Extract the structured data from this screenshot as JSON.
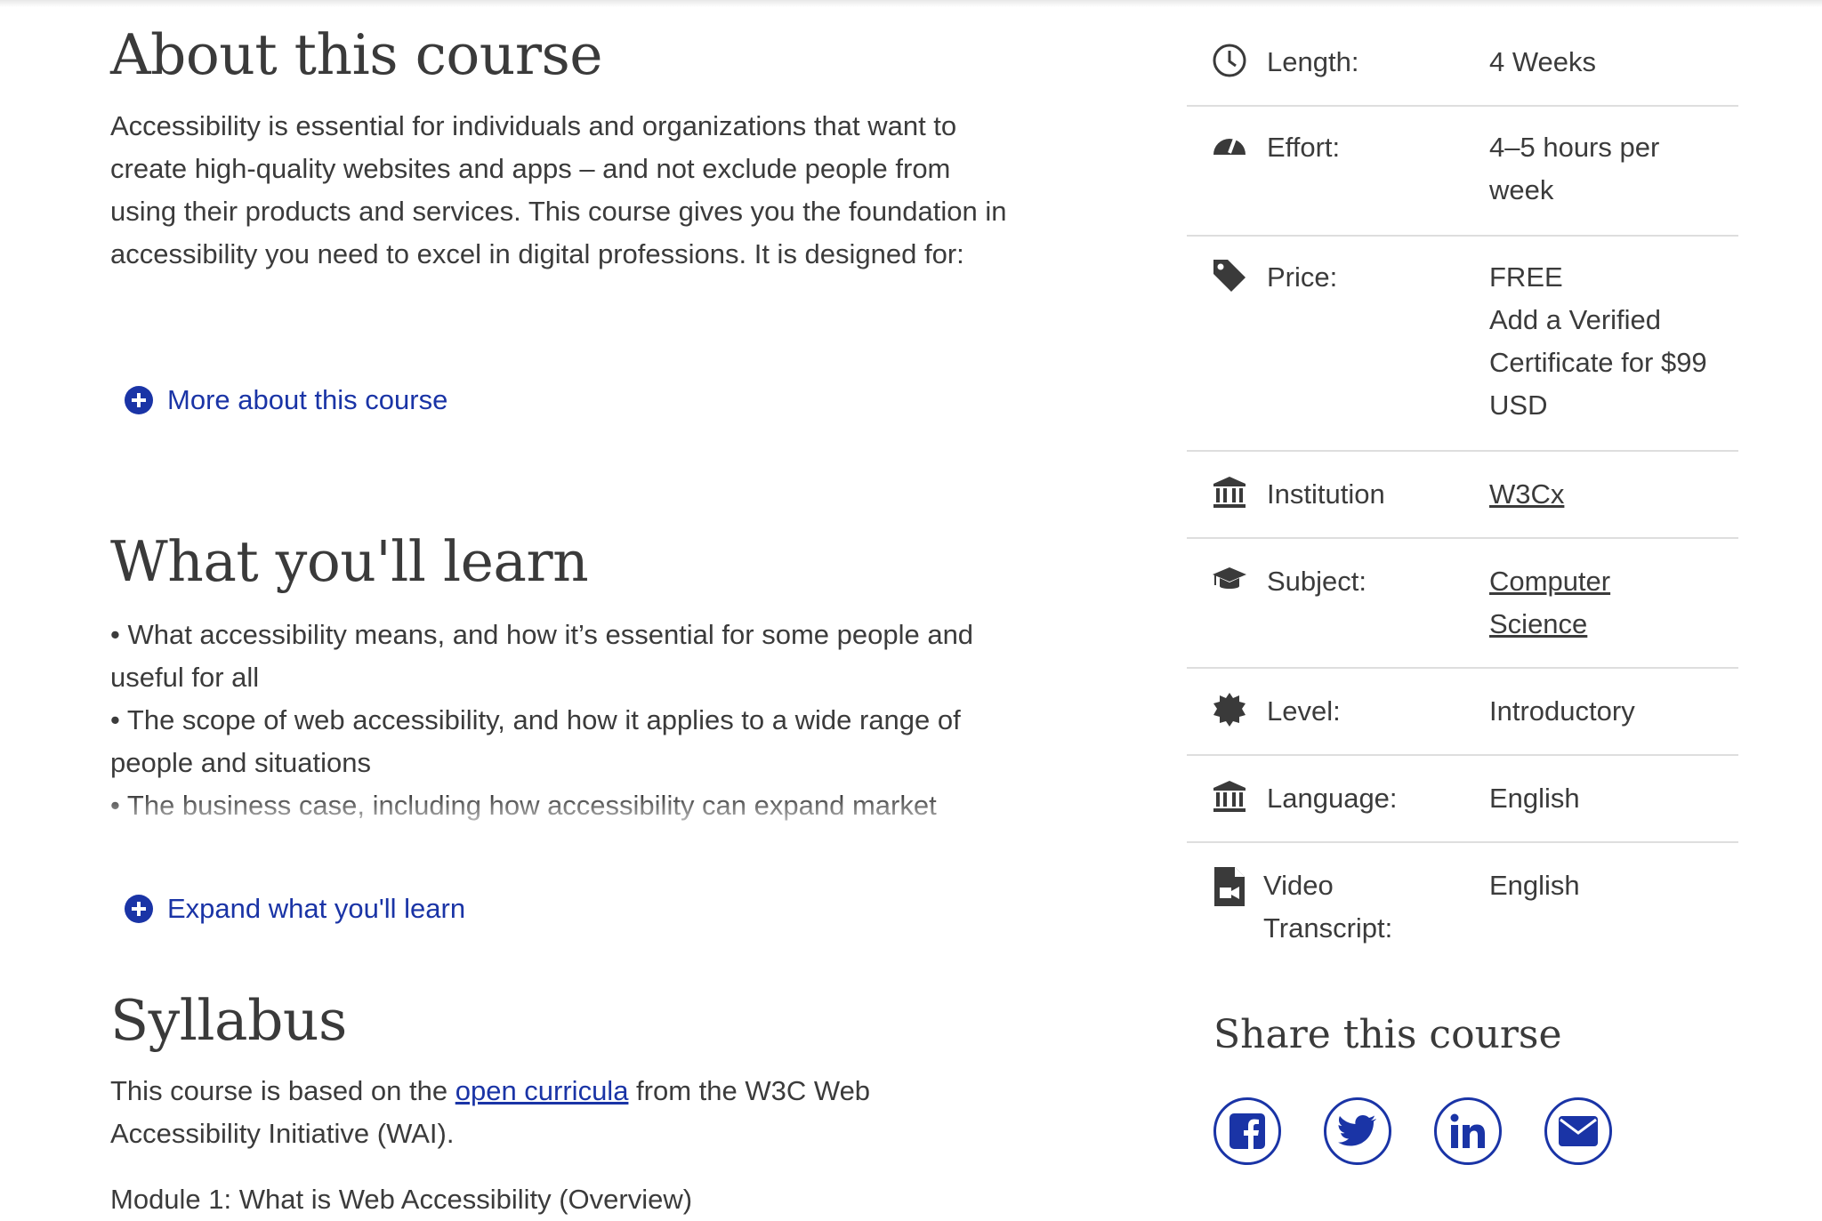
{
  "about": {
    "heading": "About this course",
    "body": "Accessibility is essential for individuals and organizations that want to create high-quality websites and apps – and not exclude people from using their products and services. This course gives you the foundation in accessibility you need to excel in digital professions. It is designed for:",
    "more_label": "More about this course"
  },
  "learn": {
    "heading": "What you'll learn",
    "items": [
      "• What accessibility means, and how it’s essential for some people and useful for all",
      "• The scope of web accessibility, and how it applies to a wide range of people and situations",
      "• The business case, including how accessibility can expand market reach, demonstrate social responsibility, drive innovation, and minimize"
    ],
    "expand_label": "Expand what you'll learn"
  },
  "syllabus": {
    "heading": "Syllabus",
    "text_before": "This course is based on the ",
    "link_text": "open curricula",
    "text_after": " from the W3C Web Accessibility Initiative (WAI).",
    "next_line": "Module 1: What is Web Accessibility (Overview)"
  },
  "details": {
    "length": {
      "label": "Length:",
      "value": "4 Weeks",
      "icon": "clock-icon"
    },
    "effort": {
      "label": "Effort:",
      "value": "4–5 hours per week",
      "icon": "gauge-icon"
    },
    "price": {
      "label": "Price:",
      "value_lines": [
        "FREE",
        "Add a Verified Certificate for $99 USD"
      ],
      "icon": "tag-icon"
    },
    "institution": {
      "label": "Institution",
      "value": "W3Cx",
      "icon": "institution-icon"
    },
    "subject": {
      "label": "Subject:",
      "value": "Computer Science",
      "icon": "graduation-cap-icon"
    },
    "level": {
      "label": "Level:",
      "value": "Introductory",
      "icon": "badge-icon"
    },
    "language": {
      "label": "Language:",
      "value": "English",
      "icon": "institution-icon"
    },
    "transcript": {
      "label": "Video Transcript:",
      "value": "English",
      "icon": "video-file-icon"
    }
  },
  "share": {
    "heading": "Share this course",
    "buttons": [
      "facebook-icon",
      "twitter-icon",
      "linkedin-icon",
      "email-icon"
    ]
  },
  "colors": {
    "link": "#1a34a6",
    "text": "#3b3b3b",
    "divider": "#dedede"
  }
}
